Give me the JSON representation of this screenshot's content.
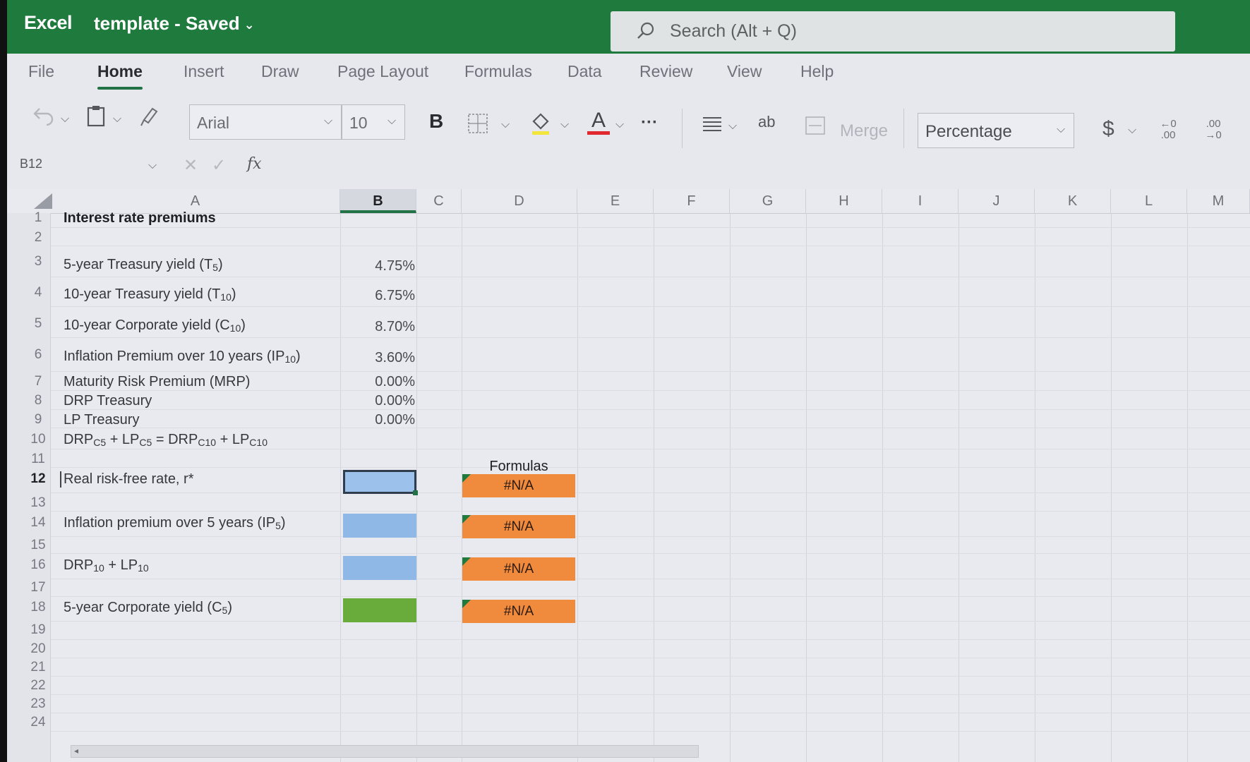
{
  "app": {
    "name": "Excel",
    "document": "template - Saved"
  },
  "search": {
    "placeholder": "Search (Alt + Q)"
  },
  "menu": [
    {
      "label": "File"
    },
    {
      "label": "Home"
    },
    {
      "label": "Insert"
    },
    {
      "label": "Draw"
    },
    {
      "label": "Page Layout"
    },
    {
      "label": "Formulas"
    },
    {
      "label": "Data"
    },
    {
      "label": "Review"
    },
    {
      "label": "View"
    },
    {
      "label": "Help"
    }
  ],
  "ribbon": {
    "font": "Arial",
    "size": "10",
    "bold": "B",
    "more": "···",
    "merge": "Merge",
    "number_format": "Percentage",
    "currency": "$",
    "font_color_glyph": "A",
    "wrap_glyph": "ab",
    "dec_increase": "←0 .00",
    "dec_decrease": ".00 →0"
  },
  "formula_bar": {
    "name_box": "B12",
    "fx": "fx"
  },
  "columns": [
    "A",
    "B",
    "C",
    "D",
    "E",
    "F",
    "G",
    "H",
    "I",
    "J",
    "K",
    "L",
    "M"
  ],
  "rows": [
    "1",
    "2",
    "3",
    "4",
    "5",
    "6",
    "7",
    "8",
    "9",
    "10",
    "11",
    "12",
    "13",
    "14",
    "15",
    "16",
    "17",
    "18",
    "19",
    "20",
    "21",
    "22",
    "23",
    "24"
  ],
  "sheet": {
    "title": "Interest rate premiums",
    "r3_a": "5-year Treasury yield (T",
    "r3_sub": "5",
    "r3_end": ")",
    "r3_b": "4.75%",
    "r4_a": "10-year Treasury yield (T",
    "r4_sub": "10",
    "r4_end": ")",
    "r4_b": "6.75%",
    "r5_a": "10-year Corporate yield (C",
    "r5_sub": "10",
    "r5_end": ")",
    "r5_b": "8.70%",
    "r6_a": "Inflation Premium over 10 years (IP",
    "r6_sub": "10",
    "r6_end": ")",
    "r6_b": "3.60%",
    "r7_a": "Maturity Risk Premium (MRP)",
    "r7_b": "0.00%",
    "r8_a": "DRP Treasury",
    "r8_b": "0.00%",
    "r9_a": "LP Treasury",
    "r9_b": "0.00%",
    "r10_p1": "DRP",
    "r10_s1": "C5",
    "r10_p2": " + LP",
    "r10_s2": "C5",
    "r10_p3": " = DRP",
    "r10_s3": "C10",
    "r10_p4": " + LP",
    "r10_s4": "C10",
    "r12_a": "Real risk-free rate, r*",
    "r14_a": "Inflation premium over 5 years (IP",
    "r14_sub": "5",
    "r14_end": ")",
    "r16_p1": "DRP",
    "r16_s1": "10",
    "r16_p2": " + LP",
    "r16_s2": "10",
    "r18_a": "5-year Corporate yield (C",
    "r18_sub": "5",
    "r18_end": ")",
    "formulas_label": "Formulas",
    "na": "#N/A"
  },
  "colors": {
    "title_bar": "#1f7a3e",
    "input_fill": "#8fb8e6",
    "result_fill": "#6aac3c",
    "formula_fill": "#f08a3c"
  }
}
